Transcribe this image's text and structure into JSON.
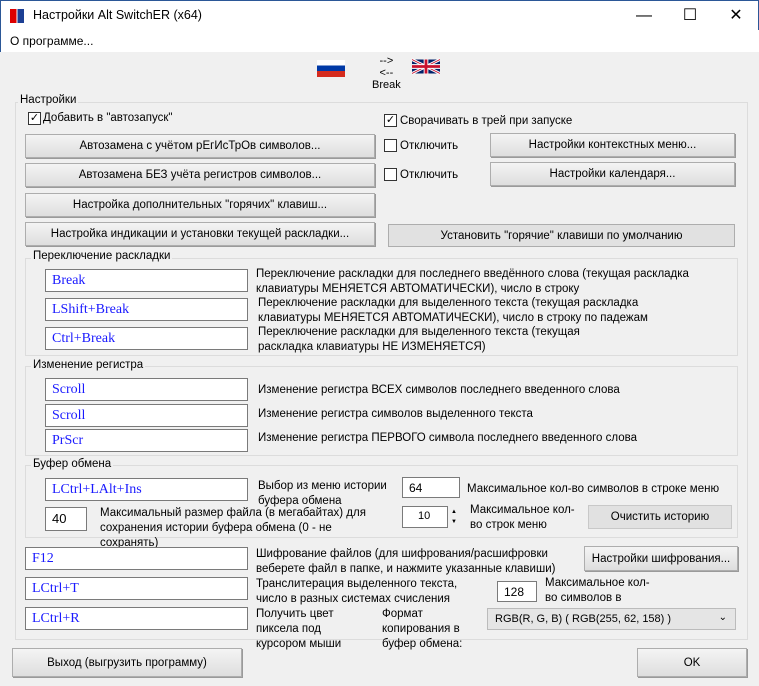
{
  "window": {
    "title": "Настройки Alt SwitchER (x64)",
    "minimize": "—",
    "maximize": "☐",
    "close": "✕"
  },
  "menu": {
    "about": "О программе..."
  },
  "flags": {
    "from": "russia-flag",
    "to": "uk-flag",
    "arrow_right": "-->",
    "arrow_left": "<--",
    "key": "Break"
  },
  "settings": {
    "group_label": "Настройки",
    "autostart": {
      "label": "Добавить в \"автозапуск\"",
      "checked": true
    },
    "tray": {
      "label": "Сворачивать в трей при запуске",
      "checked": true
    },
    "autoreplace_case": "Автозамена с учётом рЕгИсТрОв символов...",
    "disable1": {
      "label": "Отключить",
      "checked": false
    },
    "context_menu": "Настройки контекстных меню...",
    "autoreplace_nocase": "Автозамена БЕЗ учёта регистров символов...",
    "disable2": {
      "label": "Отключить",
      "checked": false
    },
    "calendar": "Настройки календаря...",
    "extra_hotkeys": "Настройка дополнительных \"горячих\" клавиш...",
    "indication": "Настройка индикации и установки текущей раскладки...",
    "default_hotkeys": "Установить \"горячие\" клавиши по умолчанию"
  },
  "layout_switch": {
    "group_label": "Переключение раскладки",
    "rows": [
      {
        "key": "Break",
        "desc": "Переключение раскладки для последнего введённого слова (текущая раскладка клавиатуры МЕНЯЕТСЯ АВТОМАТИЧЕСКИ), число в строку"
      },
      {
        "key": "LShift+Break",
        "desc": "Переключение раскладки для выделенного текста (текущая раскладка клавиатуры МЕНЯЕТСЯ АВТОМАТИЧЕСКИ), число в строку по падежам"
      },
      {
        "key": "Ctrl+Break",
        "desc": "Переключение раскладки для выделенного текста (текущая раскладка клавиатуры НЕ ИЗМЕНЯЕТСЯ)"
      }
    ]
  },
  "case_change": {
    "group_label": "Изменение регистра",
    "rows": [
      {
        "key": "Scroll",
        "desc": "Изменение регистра ВСЕХ символов последнего введенного слова"
      },
      {
        "key": "Scroll",
        "desc": "Изменение регистра символов выделенного текста"
      },
      {
        "key": "PrScr",
        "desc": "Изменение регистра ПЕРВОГО символа последнего введенного слова"
      }
    ]
  },
  "clipboard": {
    "group_label": "Буфер обмена",
    "history_key": "LCtrl+LAlt+Ins",
    "history_desc": "Выбор из меню истории буфера обмена",
    "max_chars": "64",
    "max_chars_label": "Максимальное кол-во символов в строке меню",
    "max_size": "40",
    "max_size_label": "Максимальный размер файла (в мегабайтах) для сохранения истории буфера обмена (0 - не сохранять)",
    "max_rows": "10",
    "max_rows_label": "Максимальное кол-во строк меню",
    "clear": "Очистить историю"
  },
  "encryption": {
    "key": "F12",
    "desc": "Шифрование файлов (для шифрования/расшифровки веберете файл в папке, и нажмите указанные клавиши)",
    "settings": "Настройки шифрования..."
  },
  "translit": {
    "key": "LCtrl+T",
    "desc": "Транслитерация выделенного текста, число в разных системах счисления",
    "max_chars": "128",
    "max_chars_label": "Максимальное кол-во символов в строке меню"
  },
  "color": {
    "key": "LCtrl+R",
    "desc": "Получить цвет пиксела под курсором мыши",
    "format_label": "Формат копирования в буфер обмена:",
    "format_value": "RGB(R, G, B)  ( RGB(255, 62, 158) )"
  },
  "footer": {
    "exit": "Выход (выгрузить программу)",
    "ok": "OK"
  }
}
